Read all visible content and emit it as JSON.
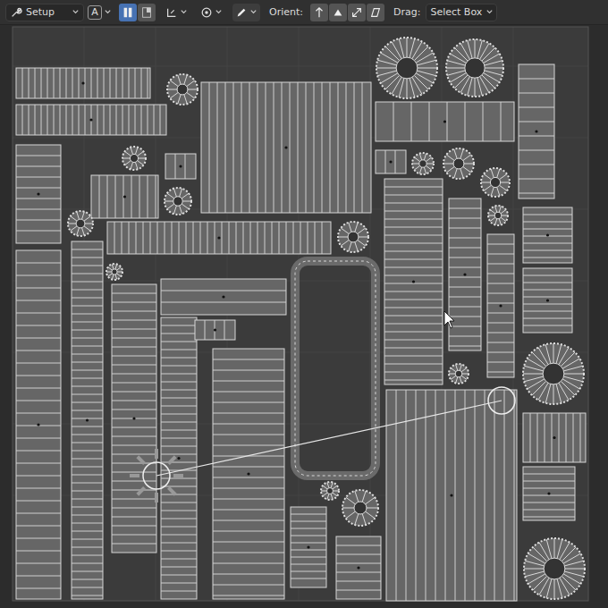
{
  "editor": "UV Editor",
  "toolbar": {
    "workspace": {
      "label": "Setup"
    },
    "auto_button": {
      "label": "A",
      "selected": false
    },
    "view_toggles": [
      {
        "selected": true
      },
      {
        "selected": false
      }
    ],
    "orient": {
      "label": "Orient:",
      "buttons": [
        {
          "selected": false
        },
        {
          "selected": false
        },
        {
          "selected": false
        },
        {
          "selected": false
        }
      ]
    },
    "drag": {
      "label": "Drag:",
      "value": "Select Box"
    }
  },
  "canvas": {
    "stitch_active": true
  }
}
